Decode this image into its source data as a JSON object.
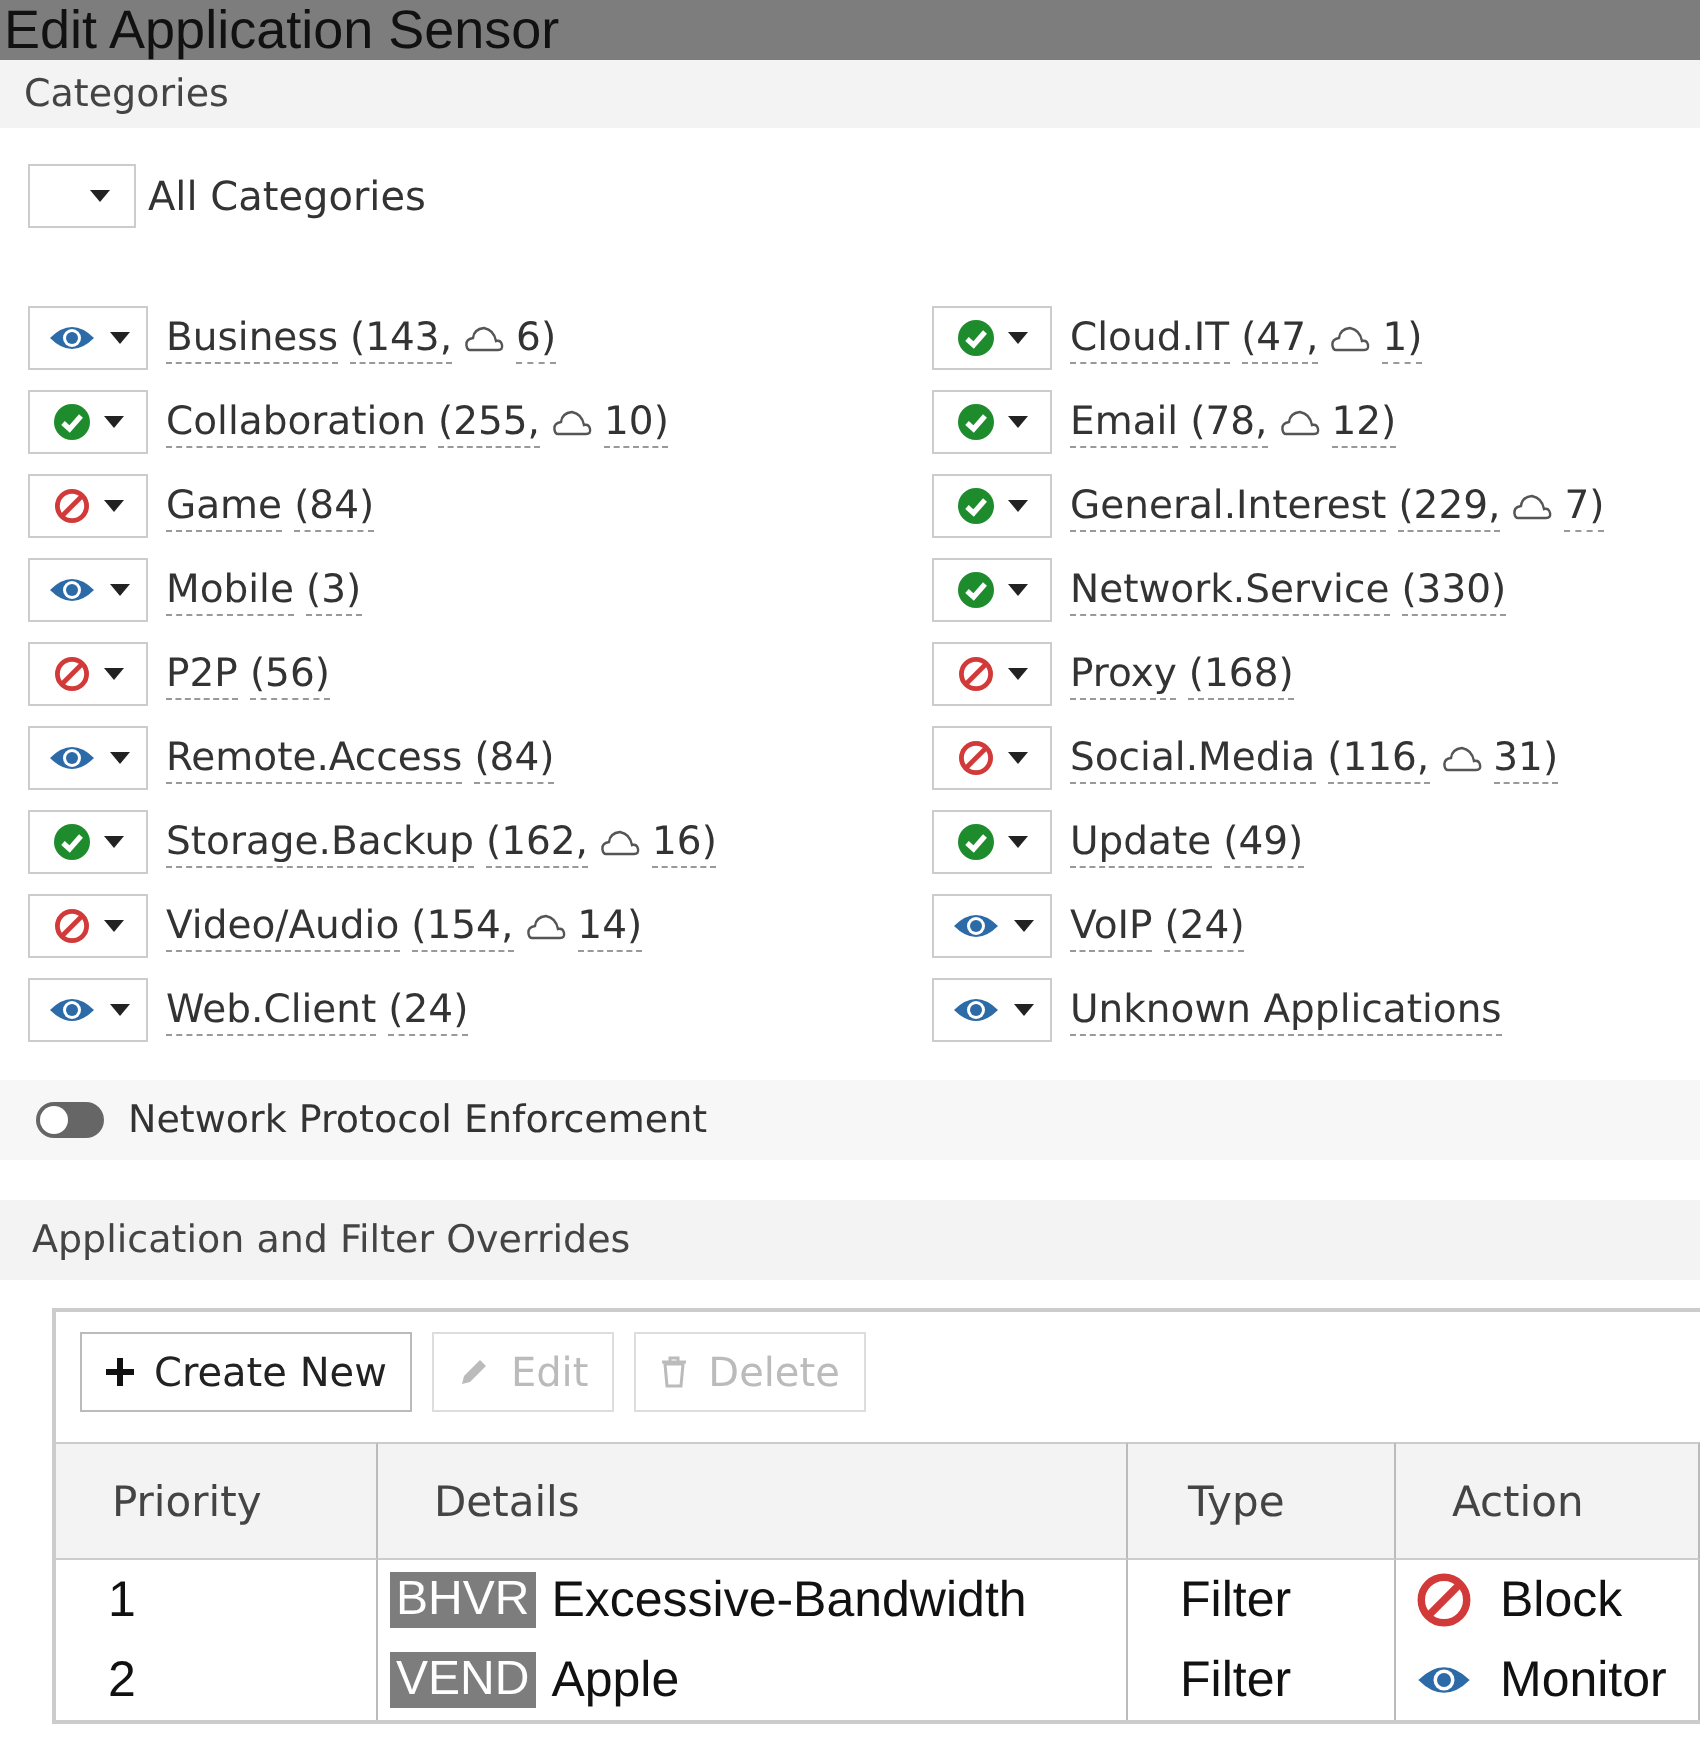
{
  "window": {
    "title": "Edit Application Sensor"
  },
  "categories_section": {
    "title": "Categories",
    "all_categories": {
      "label": "All Categories"
    },
    "items": [
      {
        "name": "Business",
        "count": "(143,",
        "cloud": "6)",
        "kind": "monitor"
      },
      {
        "name": "Cloud.IT",
        "count": "(47,",
        "cloud": "1)",
        "kind": "allow"
      },
      {
        "name": "Collaboration",
        "count": "(255,",
        "cloud": "10)",
        "kind": "allow"
      },
      {
        "name": "Email",
        "count": "(78,",
        "cloud": "12)",
        "kind": "allow"
      },
      {
        "name": "Game",
        "count": "(84)",
        "kind": "block"
      },
      {
        "name": "General.Interest",
        "count": "(229,",
        "cloud": "7)",
        "kind": "allow"
      },
      {
        "name": "Mobile",
        "count": "(3)",
        "kind": "monitor"
      },
      {
        "name": "Network.Service",
        "count": "(330)",
        "kind": "allow"
      },
      {
        "name": "P2P",
        "count": "(56)",
        "kind": "block"
      },
      {
        "name": "Proxy",
        "count": "(168)",
        "kind": "block"
      },
      {
        "name": "Remote.Access",
        "count": "(84)",
        "kind": "monitor"
      },
      {
        "name": "Social.Media",
        "count": "(116,",
        "cloud": "31)",
        "kind": "block"
      },
      {
        "name": "Storage.Backup",
        "count": "(162,",
        "cloud": "16)",
        "kind": "allow"
      },
      {
        "name": "Update",
        "count": "(49)",
        "kind": "allow"
      },
      {
        "name": "Video/Audio",
        "count": "(154,",
        "cloud": "14)",
        "kind": "block"
      },
      {
        "name": "VoIP",
        "count": "(24)",
        "kind": "monitor"
      },
      {
        "name": "Web.Client",
        "count": "(24)",
        "kind": "monitor"
      },
      {
        "name": "Unknown Applications",
        "kind": "monitor"
      }
    ]
  },
  "network_protocol_enforcement": {
    "label": "Network Protocol Enforcement",
    "on": false
  },
  "overrides_section": {
    "title": "Application and Filter Overrides",
    "toolbar": [
      {
        "label": "Create New",
        "kind": "create",
        "disabled": false
      },
      {
        "label": "Edit",
        "kind": "edit",
        "disabled": true
      },
      {
        "label": "Delete",
        "kind": "delete",
        "disabled": true
      }
    ],
    "table": {
      "columns": [
        "Priority",
        "Details",
        "Type",
        "Action"
      ],
      "rows": [
        {
          "priority": "1",
          "tag": "BHVR",
          "details": "Excessive-Bandwidth",
          "type": "Filter",
          "action": "Block",
          "kind": "block"
        },
        {
          "priority": "2",
          "tag": "VEND",
          "details": "Apple",
          "type": "Filter",
          "action": "Monitor",
          "kind": "monitor"
        }
      ]
    }
  }
}
